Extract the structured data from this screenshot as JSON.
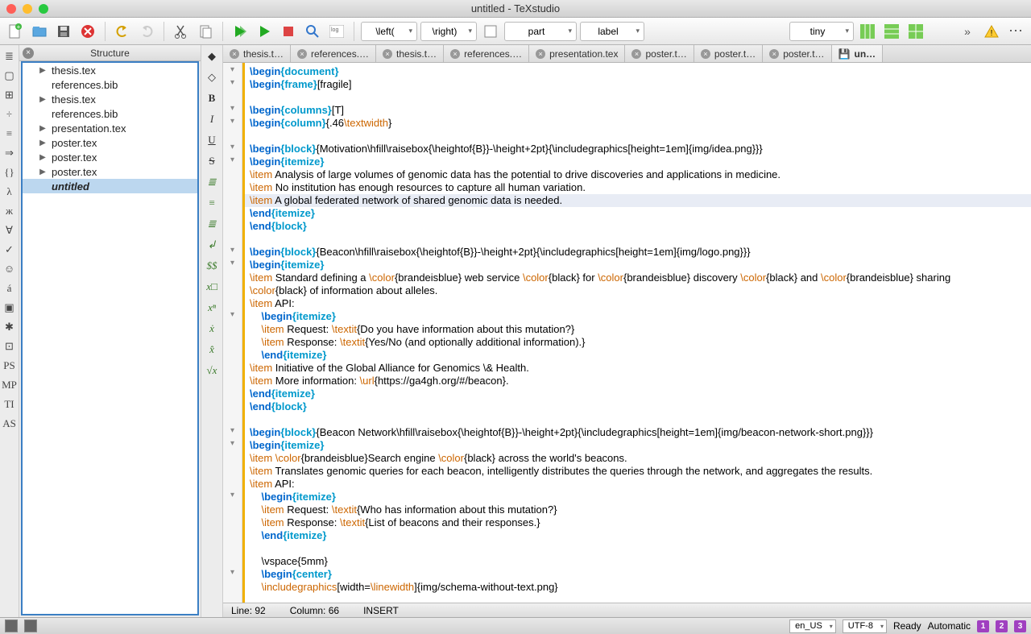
{
  "window": {
    "title": "untitled - TeXstudio"
  },
  "toolbar": {
    "combos": [
      "\\left(",
      "\\right)",
      "part",
      "label",
      "tiny"
    ]
  },
  "structure": {
    "title": "Structure",
    "items": [
      {
        "label": "thesis.tex",
        "arrow": true
      },
      {
        "label": "references.bib",
        "arrow": false
      },
      {
        "label": "thesis.tex",
        "arrow": true
      },
      {
        "label": "references.bib",
        "arrow": false
      },
      {
        "label": "presentation.tex",
        "arrow": true
      },
      {
        "label": "poster.tex",
        "arrow": true
      },
      {
        "label": "poster.tex",
        "arrow": true
      },
      {
        "label": "poster.tex",
        "arrow": true
      },
      {
        "label": "untitled",
        "arrow": false,
        "sel": true
      }
    ]
  },
  "tabs": [
    "thesis.t…",
    "references.…",
    "thesis.t…",
    "references.…",
    "presentation.tex",
    "poster.t…",
    "poster.t…",
    "poster.t…"
  ],
  "tab_last": "un…",
  "leftcol": [
    "≣",
    "▢",
    "⊞",
    "÷",
    "≡",
    "⇒",
    "{}",
    "λ",
    "ж",
    "∀",
    "✓",
    "☺",
    "á",
    "▣",
    "✱",
    "⊡",
    "PS",
    "MP",
    "TI",
    "AS"
  ],
  "midcol": [
    "◆",
    "◇",
    "B",
    "I",
    "U",
    "S",
    "≣",
    "≡",
    "≣",
    "↲",
    "$$",
    "x□",
    "xⁿ",
    "ẋ",
    "x̂",
    "√x"
  ],
  "editor_status": {
    "line": "Line: 92",
    "col": "Column: 66",
    "mode": "INSERT"
  },
  "status": {
    "lang": "en_US",
    "enc": "UTF-8",
    "ready": "Ready",
    "auto": "Automatic",
    "badges": [
      "1",
      "2",
      "3"
    ]
  },
  "code_lines": [
    {
      "fold": "▾",
      "seg": [
        {
          "c": "cmd",
          "t": "\\begin"
        },
        {
          "c": "brace",
          "t": "{document}"
        }
      ]
    },
    {
      "fold": "▾",
      "seg": [
        {
          "c": "cmd",
          "t": "\\begin"
        },
        {
          "c": "brace",
          "t": "{frame}"
        },
        {
          "c": "txt",
          "t": "[fragile]"
        }
      ]
    },
    {
      "fold": "",
      "seg": []
    },
    {
      "fold": "▾",
      "seg": [
        {
          "c": "cmd",
          "t": "\\begin"
        },
        {
          "c": "brace",
          "t": "{columns}"
        },
        {
          "c": "txt",
          "t": "[T]"
        }
      ]
    },
    {
      "fold": "▾",
      "seg": [
        {
          "c": "cmd",
          "t": "\\begin"
        },
        {
          "c": "brace",
          "t": "{column}"
        },
        {
          "c": "txt",
          "t": "{.46"
        },
        {
          "c": "opt",
          "t": "\\textwidth"
        },
        {
          "c": "txt",
          "t": "}"
        }
      ]
    },
    {
      "fold": "",
      "seg": []
    },
    {
      "fold": "▾",
      "seg": [
        {
          "c": "cmd",
          "t": "\\begin"
        },
        {
          "c": "brace",
          "t": "{block}"
        },
        {
          "c": "txt",
          "t": "{Motivation\\hfill\\raisebox{\\heightof{B}}-\\height+2pt}{\\includegraphics[height=1em]{img/idea.png}}}"
        }
      ]
    },
    {
      "fold": "▾",
      "seg": [
        {
          "c": "cmd",
          "t": "\\begin"
        },
        {
          "c": "brace",
          "t": "{itemize}"
        }
      ]
    },
    {
      "fold": "",
      "seg": [
        {
          "c": "opt",
          "t": "\\item"
        },
        {
          "c": "txt",
          "t": " Analysis of large volumes of genomic data has the potential to drive discoveries and applications in medicine."
        }
      ]
    },
    {
      "fold": "",
      "seg": [
        {
          "c": "opt",
          "t": "\\item"
        },
        {
          "c": "txt",
          "t": " No institution has enough resources to capture all human variation."
        }
      ]
    },
    {
      "fold": "",
      "hl": true,
      "seg": [
        {
          "c": "opt",
          "t": "\\item"
        },
        {
          "c": "txt",
          "t": " A global federated network of shared genomic data is needed."
        }
      ]
    },
    {
      "fold": "",
      "seg": [
        {
          "c": "cmd",
          "t": "\\end"
        },
        {
          "c": "brace",
          "t": "{itemize}"
        }
      ]
    },
    {
      "fold": "",
      "seg": [
        {
          "c": "cmd",
          "t": "\\end"
        },
        {
          "c": "brace",
          "t": "{block}"
        }
      ]
    },
    {
      "fold": "",
      "seg": []
    },
    {
      "fold": "▾",
      "seg": [
        {
          "c": "cmd",
          "t": "\\begin"
        },
        {
          "c": "brace",
          "t": "{block}"
        },
        {
          "c": "txt",
          "t": "{Beacon\\hfill\\raisebox{\\heightof{B}}-\\height+2pt}{\\includegraphics[height=1em]{img/logo.png}}}"
        }
      ]
    },
    {
      "fold": "▾",
      "seg": [
        {
          "c": "cmd",
          "t": "\\begin"
        },
        {
          "c": "brace",
          "t": "{itemize}"
        }
      ]
    },
    {
      "fold": "",
      "seg": [
        {
          "c": "opt",
          "t": "\\item"
        },
        {
          "c": "txt",
          "t": " Standard defining a "
        },
        {
          "c": "opt",
          "t": "\\color"
        },
        {
          "c": "txt",
          "t": "{brandeisblue} web service "
        },
        {
          "c": "opt",
          "t": "\\color"
        },
        {
          "c": "txt",
          "t": "{black} for "
        },
        {
          "c": "opt",
          "t": "\\color"
        },
        {
          "c": "txt",
          "t": "{brandeisblue} discovery "
        },
        {
          "c": "opt",
          "t": "\\color"
        },
        {
          "c": "txt",
          "t": "{black} and "
        },
        {
          "c": "opt",
          "t": "\\color"
        },
        {
          "c": "txt",
          "t": "{brandeisblue} sharing"
        }
      ]
    },
    {
      "fold": "",
      "seg": [
        {
          "c": "opt",
          "t": "\\color"
        },
        {
          "c": "txt",
          "t": "{black} of information about alleles."
        }
      ]
    },
    {
      "fold": "",
      "seg": [
        {
          "c": "opt",
          "t": "\\item"
        },
        {
          "c": "txt",
          "t": " API:"
        }
      ]
    },
    {
      "fold": "▾",
      "indent": 1,
      "seg": [
        {
          "c": "cmd",
          "t": "\\begin"
        },
        {
          "c": "brace",
          "t": "{itemize}"
        }
      ]
    },
    {
      "fold": "",
      "indent": 1,
      "seg": [
        {
          "c": "opt",
          "t": "\\item"
        },
        {
          "c": "txt",
          "t": " Request: "
        },
        {
          "c": "opt",
          "t": "\\textit"
        },
        {
          "c": "txt",
          "t": "{Do you have information about this mutation?}"
        }
      ]
    },
    {
      "fold": "",
      "indent": 1,
      "seg": [
        {
          "c": "opt",
          "t": "\\item"
        },
        {
          "c": "txt",
          "t": " Response: "
        },
        {
          "c": "opt",
          "t": "\\textit"
        },
        {
          "c": "txt",
          "t": "{Yes/No (and optionally additional information).}"
        }
      ]
    },
    {
      "fold": "",
      "indent": 1,
      "seg": [
        {
          "c": "cmd",
          "t": "\\end"
        },
        {
          "c": "brace",
          "t": "{itemize}"
        }
      ]
    },
    {
      "fold": "",
      "seg": [
        {
          "c": "opt",
          "t": "\\item"
        },
        {
          "c": "txt",
          "t": " Initiative of the Global Alliance for Genomics \\& Health."
        }
      ]
    },
    {
      "fold": "",
      "seg": [
        {
          "c": "opt",
          "t": "\\item"
        },
        {
          "c": "txt",
          "t": " More information: "
        },
        {
          "c": "opt",
          "t": "\\url"
        },
        {
          "c": "txt",
          "t": "{https://ga4gh.org/#/beacon}."
        }
      ]
    },
    {
      "fold": "",
      "seg": [
        {
          "c": "cmd",
          "t": "\\end"
        },
        {
          "c": "brace",
          "t": "{itemize}"
        }
      ]
    },
    {
      "fold": "",
      "seg": [
        {
          "c": "cmd",
          "t": "\\end"
        },
        {
          "c": "brace",
          "t": "{block}"
        }
      ]
    },
    {
      "fold": "",
      "seg": []
    },
    {
      "fold": "▾",
      "seg": [
        {
          "c": "cmd",
          "t": "\\begin"
        },
        {
          "c": "brace",
          "t": "{block}"
        },
        {
          "c": "txt",
          "t": "{Beacon Network\\hfill\\raisebox{\\heightof{B}}-\\height+2pt}{\\includegraphics[height=1em]{img/beacon-network-short.png}}}"
        }
      ]
    },
    {
      "fold": "▾",
      "seg": [
        {
          "c": "cmd",
          "t": "\\begin"
        },
        {
          "c": "brace",
          "t": "{itemize}"
        }
      ]
    },
    {
      "fold": "",
      "seg": [
        {
          "c": "opt",
          "t": "\\item"
        },
        {
          "c": "txt",
          "t": " "
        },
        {
          "c": "opt",
          "t": "\\color"
        },
        {
          "c": "txt",
          "t": "{brandeisblue}Search engine "
        },
        {
          "c": "opt",
          "t": "\\color"
        },
        {
          "c": "txt",
          "t": "{black} across the world's beacons."
        }
      ]
    },
    {
      "fold": "",
      "seg": [
        {
          "c": "opt",
          "t": "\\item"
        },
        {
          "c": "txt",
          "t": " Translates genomic queries for each beacon, intelligently distributes the queries through the network, and aggregates the results."
        }
      ]
    },
    {
      "fold": "",
      "seg": [
        {
          "c": "opt",
          "t": "\\item"
        },
        {
          "c": "txt",
          "t": " API:"
        }
      ]
    },
    {
      "fold": "▾",
      "indent": 1,
      "seg": [
        {
          "c": "cmd",
          "t": "\\begin"
        },
        {
          "c": "brace",
          "t": "{itemize}"
        }
      ]
    },
    {
      "fold": "",
      "indent": 1,
      "seg": [
        {
          "c": "opt",
          "t": "\\item"
        },
        {
          "c": "txt",
          "t": " Request: "
        },
        {
          "c": "opt",
          "t": "\\textit"
        },
        {
          "c": "txt",
          "t": "{Who has information about this mutation?}"
        }
      ]
    },
    {
      "fold": "",
      "indent": 1,
      "seg": [
        {
          "c": "opt",
          "t": "\\item"
        },
        {
          "c": "txt",
          "t": " Response: "
        },
        {
          "c": "opt",
          "t": "\\textit"
        },
        {
          "c": "txt",
          "t": "{List of beacons and their responses.}"
        }
      ]
    },
    {
      "fold": "",
      "indent": 1,
      "seg": [
        {
          "c": "cmd",
          "t": "\\end"
        },
        {
          "c": "brace",
          "t": "{itemize}"
        }
      ]
    },
    {
      "fold": "",
      "seg": []
    },
    {
      "fold": "",
      "indent": 1,
      "seg": [
        {
          "c": "txt",
          "t": "\\vspace{5mm}"
        }
      ]
    },
    {
      "fold": "▾",
      "indent": 1,
      "seg": [
        {
          "c": "cmd",
          "t": "\\begin"
        },
        {
          "c": "brace",
          "t": "{center}"
        }
      ]
    },
    {
      "fold": "",
      "indent": 1,
      "seg": [
        {
          "c": "opt",
          "t": "\\includegraphics"
        },
        {
          "c": "txt",
          "t": "[width="
        },
        {
          "c": "opt",
          "t": "\\linewidth"
        },
        {
          "c": "txt",
          "t": "]{img/schema-without-text.png}"
        }
      ]
    }
  ]
}
